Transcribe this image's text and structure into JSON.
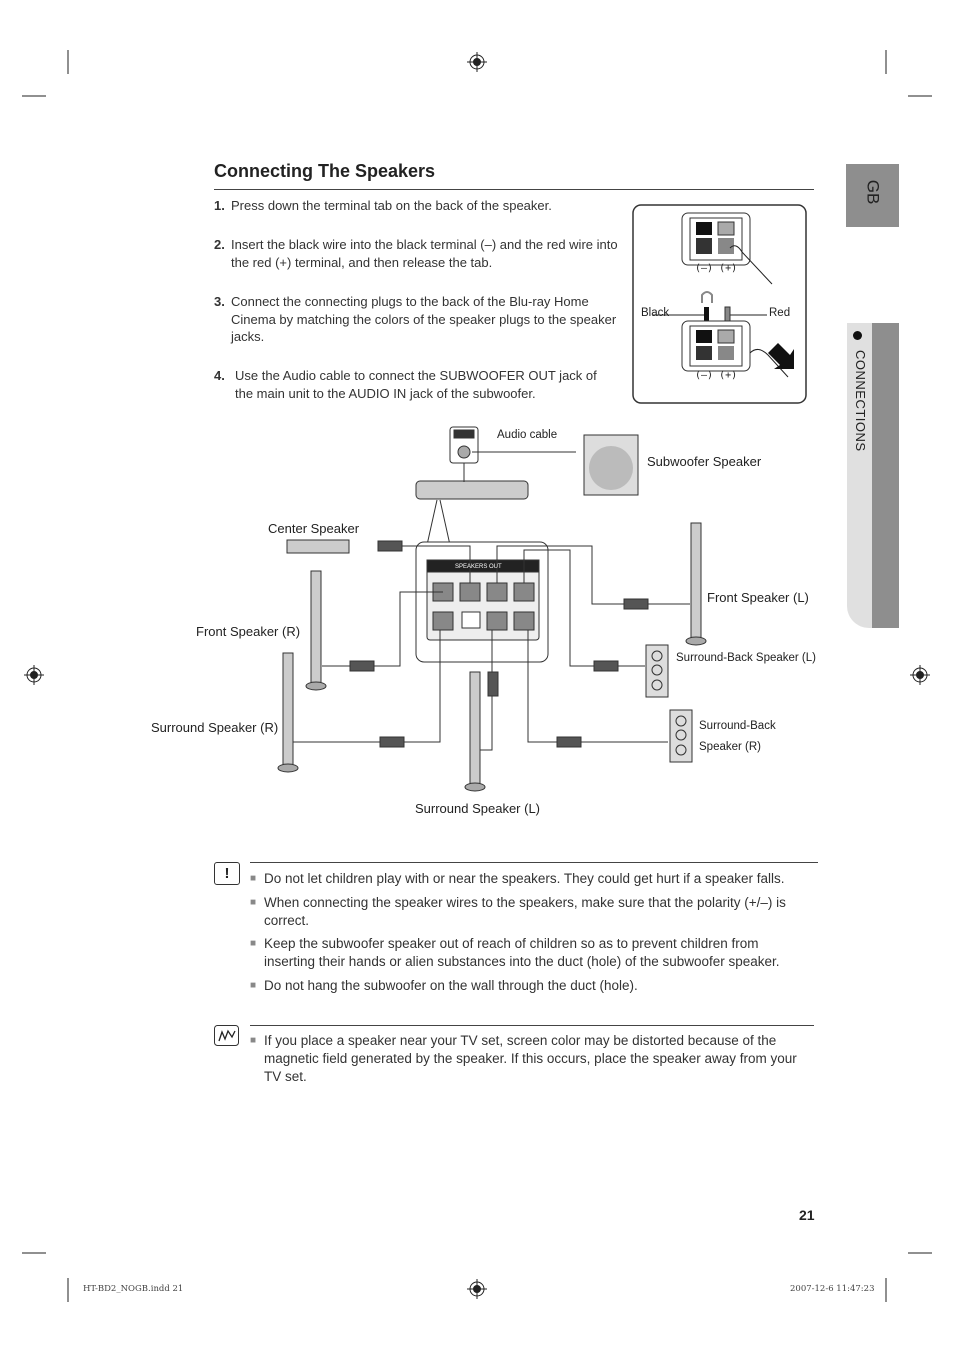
{
  "section_title": "Connecting The Speakers",
  "steps": [
    {
      "num": "1.",
      "text": "Press down the terminal tab on the back of the speaker."
    },
    {
      "num": "2.",
      "text": "Insert the black wire into the black terminal (–) and the red wire into the red (+) terminal, and then release the tab."
    },
    {
      "num": "3.",
      "text": "Connect the connecting plugs to the back of the Blu-ray Home Cinema by matching the colors of the speaker plugs to the speaker jacks."
    },
    {
      "num": "4.",
      "text": "Use the Audio cable to connect the SUBWOOFER OUT jack of the main unit to the AUDIO IN jack of the subwoofer."
    }
  ],
  "terminal_figure": {
    "minus": "(–)",
    "plus": "(+)",
    "black": "Black",
    "red": "Red"
  },
  "diagram": {
    "audio_cable": "Audio cable",
    "subwoofer": "Subwoofer Speaker",
    "center": "Center Speaker",
    "front_l": "Front Speaker (L)",
    "front_r": "Front Speaker (R)",
    "surround_back_l": "Surround-Back Speaker (L)",
    "surround_r": "Surround Speaker (R)",
    "surround_back_r_1": "Surround-Back",
    "surround_back_r_2": "Speaker (R)",
    "surround_l": "Surround Speaker (L)",
    "panel_title": "SPEAKERS OUT"
  },
  "cautions": [
    "Do not let children play with or near the speakers. They could get hurt if a speaker falls.",
    "When connecting the speaker wires to the speakers, make sure that the polarity (+/–) is correct.",
    "Keep the subwoofer speaker out of reach of children so as to prevent children from inserting their hands or alien substances into the duct (hole) of the subwoofer speaker.",
    "Do not hang the subwoofer on the wall through the duct (hole)."
  ],
  "notes": [
    "If you place a speaker near your TV set, screen color may be distorted because of the magnetic field generated by the speaker. If this occurs, place the speaker away from your TV set."
  ],
  "side_tabs": {
    "language": "GB",
    "chapter": "CONNECTIONS"
  },
  "page_number": "21",
  "footer": {
    "file": "HT-BD2_NOGB.indd   21",
    "datetime": "2007-12-6   11:47:23"
  },
  "icons": {
    "caution": "exclamation-icon",
    "note": "note-pencil-icon",
    "registration": "crosshair-icon"
  }
}
